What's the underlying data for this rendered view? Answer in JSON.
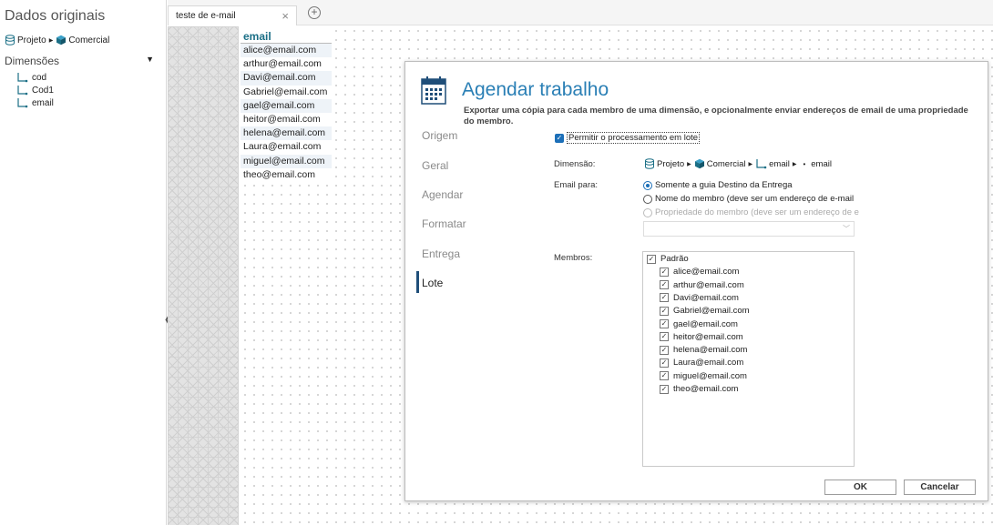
{
  "sidebar": {
    "title": "Dados originais",
    "source_path": [
      "Projeto",
      "Comercial"
    ],
    "dimensions_header": "Dimensões",
    "dimensions": [
      "cod",
      "Cod1",
      "email"
    ]
  },
  "tabs": {
    "active_label": "teste de e-mail",
    "close_glyph": "×",
    "add_glyph": "+"
  },
  "canvas": {
    "column_header": "email",
    "rows": [
      "alice@email.com",
      "arthur@email.com",
      "Davi@email.com",
      "Gabriel@email.com",
      "gael@email.com",
      "heitor@email.com",
      "helena@email.com",
      "Laura@email.com",
      "miguel@email.com",
      "theo@email.com"
    ]
  },
  "dialog": {
    "title": "Agendar trabalho",
    "subtitle": "Exportar uma cópia para cada membro de uma dimensão, e opcionalmente enviar endereços de email de uma propriedade do membro.",
    "nav": [
      "Origem",
      "Geral",
      "Agendar",
      "Formatar",
      "Entrega",
      "Lote"
    ],
    "active_nav": "Lote",
    "batch_checkbox_label": "Permitir o processamento em lote",
    "batch_checked": true,
    "dimension_label": "Dimensão:",
    "dimension_path": [
      "Projeto",
      "Comercial",
      "email",
      "email"
    ],
    "email_for_label": "Email para:",
    "email_options": [
      "Somente a guia Destino da Entrega",
      "Nome do membro (deve ser um endereço de e-mail",
      "Propriedade do membro (deve ser um endereço de e"
    ],
    "email_selected_index": 0,
    "members_label": "Membros:",
    "members_root": "Padrão",
    "members": [
      "alice@email.com",
      "arthur@email.com",
      "Davi@email.com",
      "Gabriel@email.com",
      "gael@email.com",
      "heitor@email.com",
      "helena@email.com",
      "Laura@email.com",
      "miguel@email.com",
      "theo@email.com"
    ],
    "ok_label": "OK",
    "cancel_label": "Cancelar"
  },
  "colors": {
    "accent": "#2a7fb5",
    "header_teal": "#1b6f86",
    "check_blue": "#1c6fb8",
    "nav_bar": "#1f4e79"
  },
  "icons": {
    "database": "database-icon",
    "cube": "cube-icon",
    "hierarchy": "hierarchy-icon",
    "calendar": "calendar-icon",
    "member_checkbox": "member-leaf-icon"
  }
}
